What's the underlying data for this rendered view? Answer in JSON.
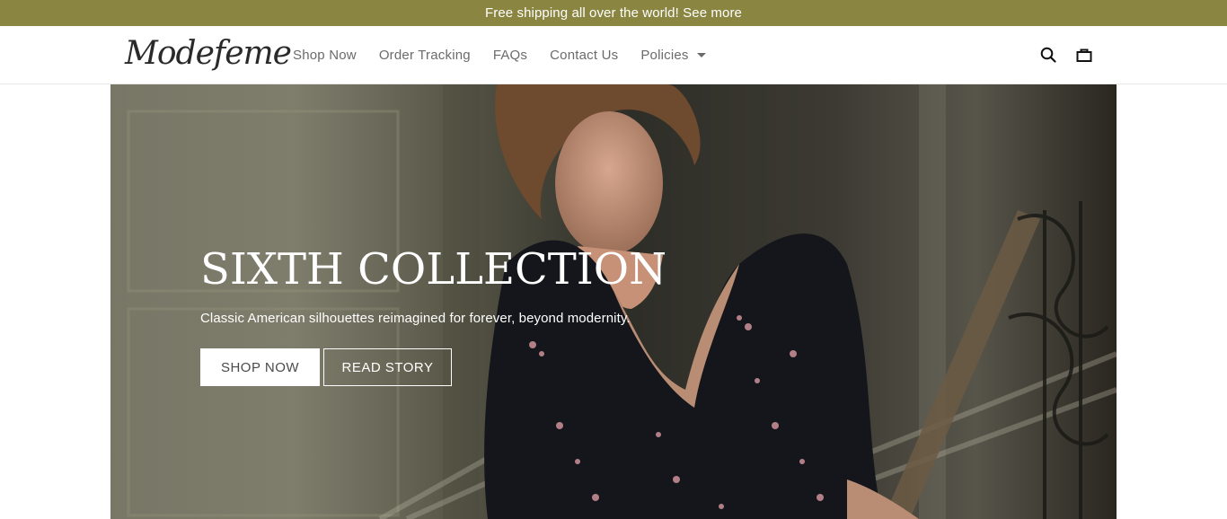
{
  "announcement": {
    "text": "Free shipping all over the world! See more"
  },
  "header": {
    "logo": "Modefeme",
    "nav": [
      {
        "label": "Shop Now"
      },
      {
        "label": "Order Tracking"
      },
      {
        "label": "FAQs"
      },
      {
        "label": "Contact Us"
      },
      {
        "label": "Policies"
      }
    ],
    "icons": [
      "search-icon",
      "shopping-bag-icon",
      "chevron-down-icon"
    ]
  },
  "hero": {
    "title": "SIXTH COLLECTION",
    "subtitle": "Classic American silhouettes reimagined for forever, beyond modernity.",
    "primary_button": "SHOP NOW",
    "secondary_button": "READ STORY"
  },
  "colors": {
    "announcement_bg": "#8a8541",
    "text_dark": "#2a2a2a",
    "nav_text": "#6b6b6b",
    "hero_text": "#ffffff"
  }
}
